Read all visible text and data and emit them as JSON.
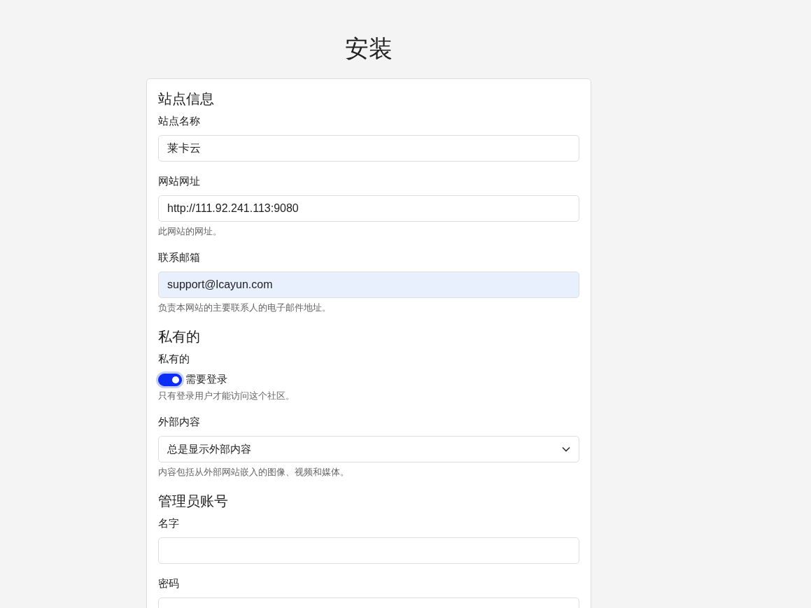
{
  "page": {
    "title": "安装"
  },
  "sections": [
    {
      "heading": "站点信息",
      "fields": [
        {
          "kind": "text",
          "label": "站点名称",
          "value": "莱卡云",
          "autofilled": false
        },
        {
          "kind": "text",
          "label": "网站网址",
          "value": "http://111.92.241.113:9080",
          "autofilled": false,
          "help": "此网站的网址。"
        },
        {
          "kind": "text",
          "label": "联系邮箱",
          "value": "support@lcayun.com",
          "autofilled": true,
          "help": "负责本网站的主要联系人的电子邮件地址。"
        }
      ]
    },
    {
      "heading": "私有的",
      "fields": [
        {
          "kind": "toggle",
          "label": "私有的",
          "option": "需要登录",
          "on": true,
          "help": "只有登录用户才能访问这个社区。"
        },
        {
          "kind": "select",
          "label": "外部内容",
          "value": "总是显示外部内容",
          "help": "内容包括从外部网站嵌入的图像、视频和媒体。"
        }
      ]
    },
    {
      "heading": "管理员账号",
      "fields": [
        {
          "kind": "text",
          "label": "名字",
          "autofilled": false
        },
        {
          "kind": "text",
          "label": "密码",
          "autofilled": false
        }
      ]
    }
  ]
}
